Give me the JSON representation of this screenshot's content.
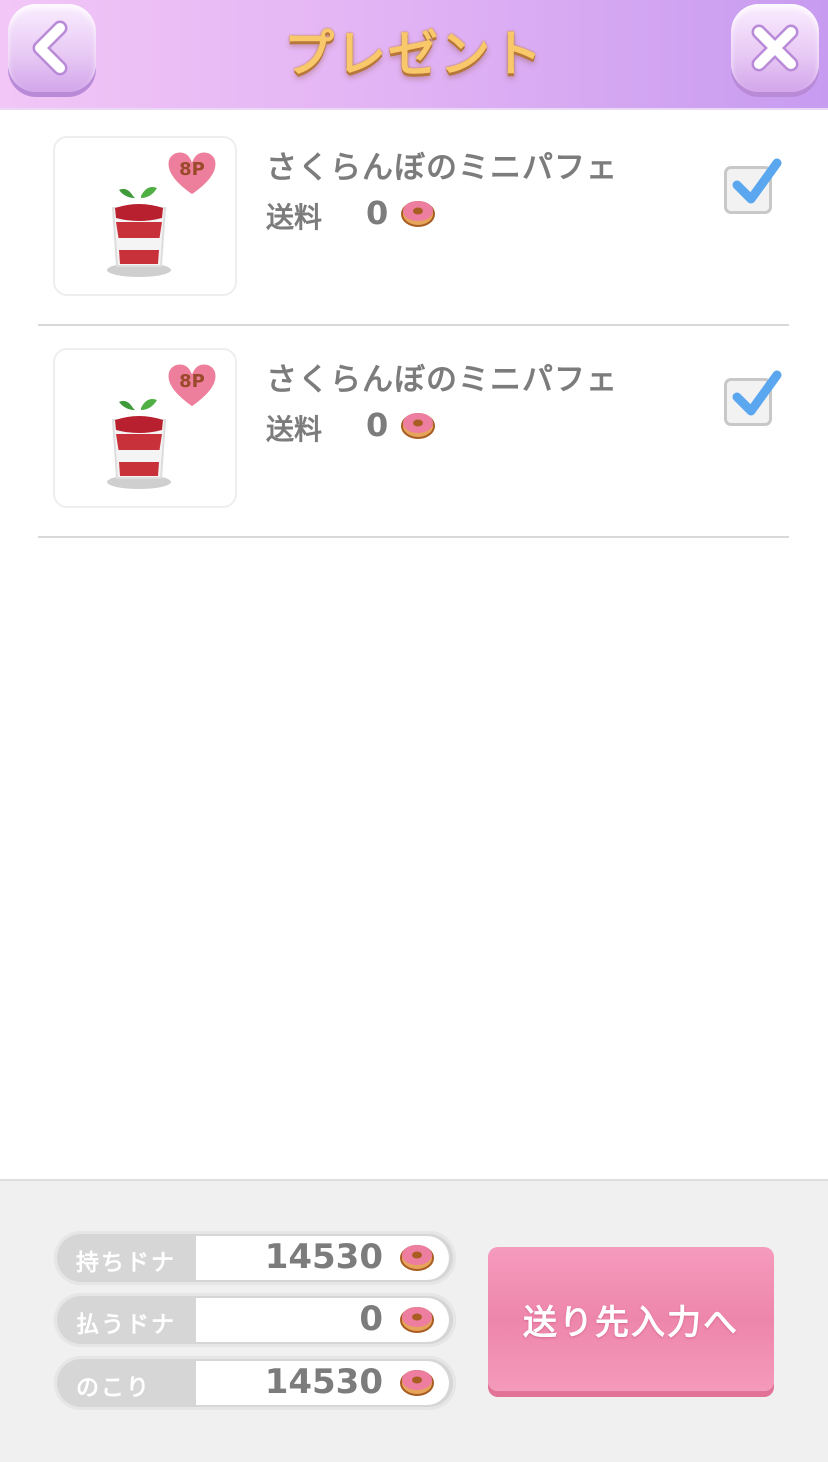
{
  "header": {
    "title": "プレゼント",
    "back_icon": "chevron-left-icon",
    "close_icon": "close-icon"
  },
  "items": [
    {
      "name": "さくらんぼのミニパフェ",
      "badge": "8P",
      "fee_label": "送料",
      "fee_value": "0",
      "checked": true
    },
    {
      "name": "さくらんぼのミニパフェ",
      "badge": "8P",
      "fee_label": "送料",
      "fee_value": "0",
      "checked": true
    }
  ],
  "footer": {
    "rows": [
      {
        "label": "持ちドナ",
        "value": "14530"
      },
      {
        "label": "払うドナ",
        "value": "0"
      },
      {
        "label": "のこり",
        "value": "14530"
      }
    ],
    "send_button": "送り先入力へ"
  },
  "colors": {
    "header_gradient": [
      "#f2c6f6",
      "#c79bf0"
    ],
    "title": "#f8c86a",
    "check": "#5aa7f0",
    "send_button": "#ee86ab"
  }
}
